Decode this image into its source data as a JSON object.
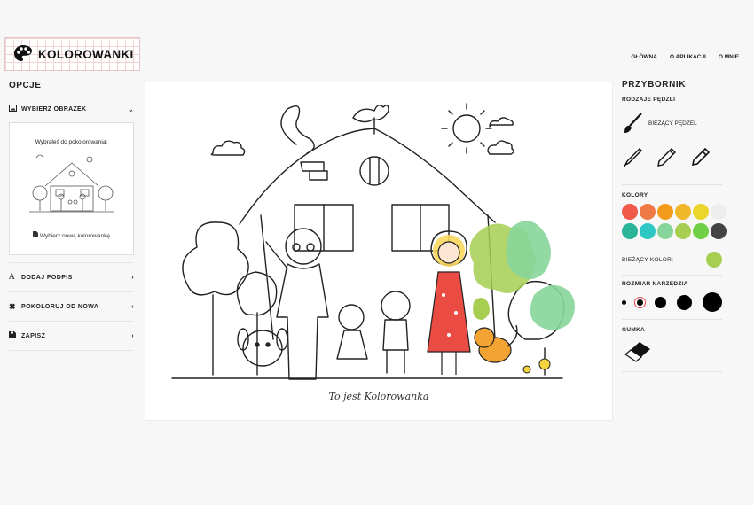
{
  "brand": {
    "name": "KOLOROWANKI"
  },
  "nav": [
    "GŁÓWNA",
    "O APLIKACJI",
    "O MNIE"
  ],
  "options": {
    "title": "OPCJE",
    "choose_image": "WYBIERZ OBRAZEK",
    "selected_text": "Wybrałeś do pokolorowania:",
    "new_image_link": "Wybierz nową kolorowankę",
    "items": [
      "DODAJ PODPIS",
      "POKOLORUJ OD NOWA",
      "ZAPISZ"
    ]
  },
  "canvas": {
    "caption": "To jest Kolorowanka"
  },
  "toolbox": {
    "title": "PRZYBORNIK",
    "brush_types_label": "RODZAJE PĘDZLI",
    "current_brush_label": "BIEŻĄCY PĘDZEL",
    "colors_label": "KOLORY",
    "colors": [
      "#f05a4a",
      "#f07a45",
      "#f39a1c",
      "#f0b72a",
      "#ecd62c",
      "#eeeeee",
      "#2ab49a",
      "#2ec7c4",
      "#86d59a",
      "#a6cf52",
      "#6fcf45",
      "#444444"
    ],
    "current_color_label": "BIEŻĄCY KOLOR:",
    "current_color": "#a6cf52",
    "tool_size_label": "ROZMIAR NARZĘDZIA",
    "eraser_label": "GUMKA"
  }
}
